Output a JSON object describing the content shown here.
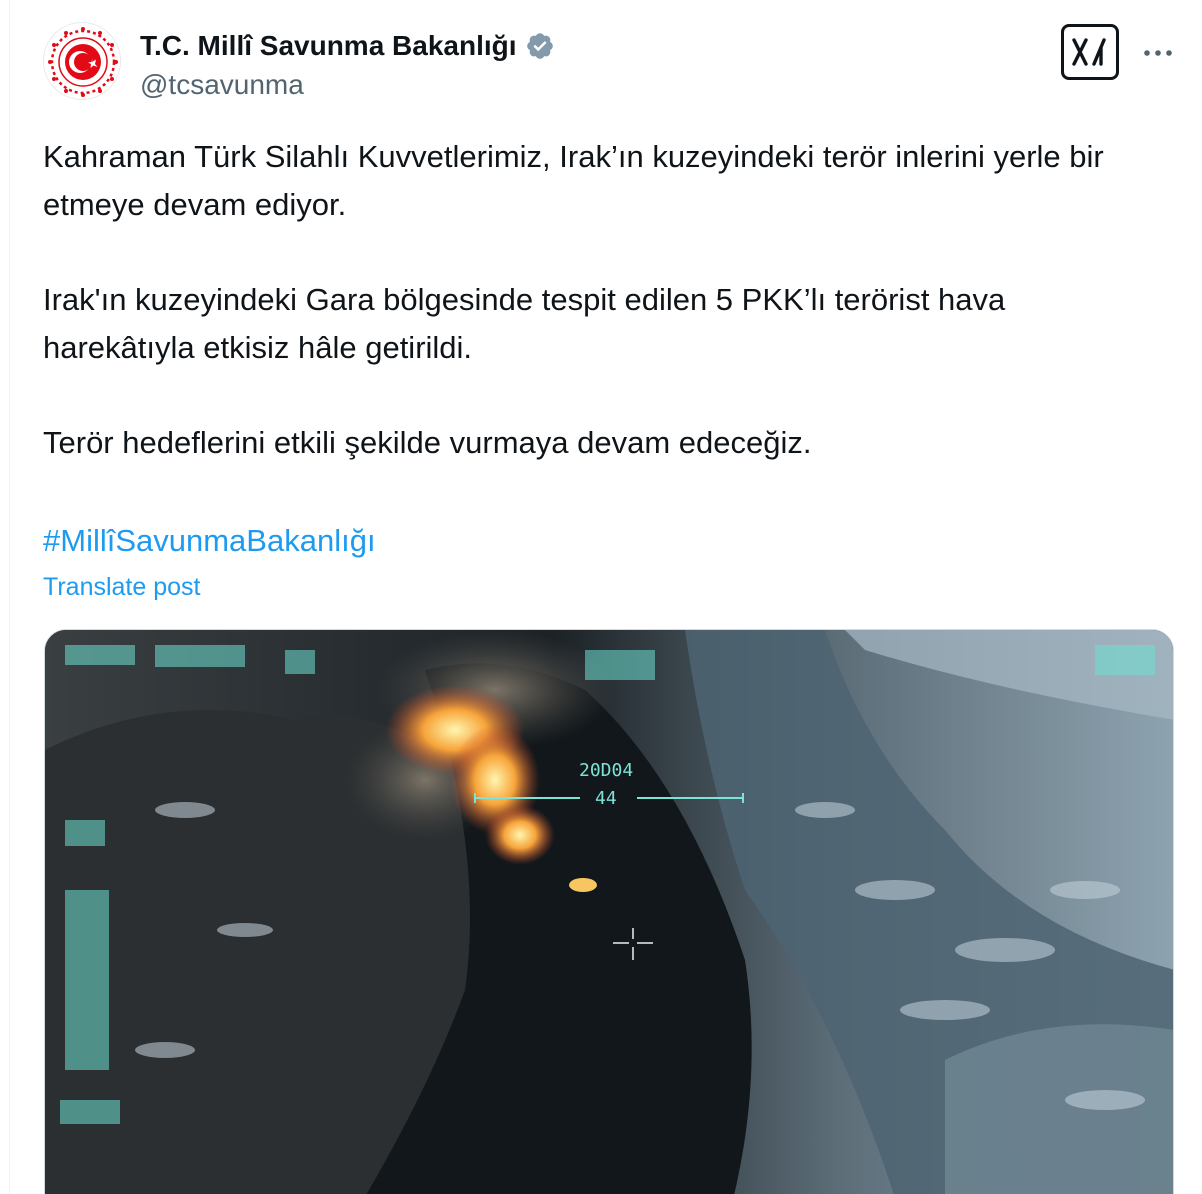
{
  "post": {
    "author": {
      "display_name": "T.C. Millî Savunma Bakanlığı",
      "handle": "@tcsavunma",
      "verified_icon": "verified-badge-icon",
      "avatar_icon": "ministry-emblem"
    },
    "paragraphs": [
      "Kahraman Türk Silahlı Kuvvetlerimiz, Irak’ın kuzeyindeki terör inlerini yerle bir etmeye devam ediyor.",
      "Irak'ın kuzeyindeki Gara bölgesinde tespit edilen 5 PKK’lı terörist hava harekâtıyla etkisiz hâle getirildi.",
      "Terör hedeflerini etkili şekilde vurmaya devam edeceğiz."
    ],
    "hashtag": "#MillîSavunmaBakanlığı",
    "translate_label": "Translate post",
    "media": {
      "type": "video-still",
      "hud_code": "20D04",
      "hud_value": "44"
    }
  },
  "toolbar": {
    "grok_icon": "x-grok-icon",
    "more_icon": "more-options-icon"
  },
  "colors": {
    "accent": "#1d9bf0",
    "text_primary": "#0f1419",
    "text_secondary": "#536471",
    "emblem_red": "#e30a17"
  }
}
